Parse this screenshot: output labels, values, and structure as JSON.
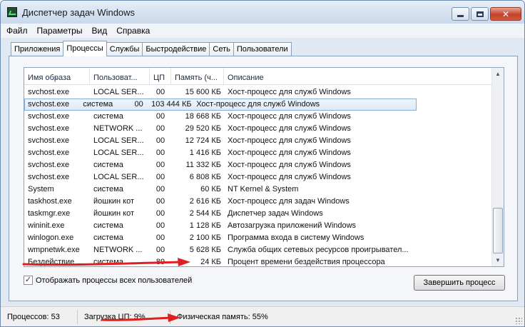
{
  "window": {
    "title": "Диспетчер задач Windows",
    "minimize_icon": "minimize-icon",
    "maximize_icon": "maximize-icon",
    "close_icon": "close-icon",
    "close_glyph": "✕"
  },
  "menu": [
    "Файл",
    "Параметры",
    "Вид",
    "Справка"
  ],
  "tabs": [
    "Приложения",
    "Процессы",
    "Службы",
    "Быстродействие",
    "Сеть",
    "Пользователи"
  ],
  "active_tab": "Процессы",
  "table": {
    "columns": [
      "Имя образа",
      "Пользоват...",
      "ЦП",
      "Память (ч...",
      "Описание"
    ],
    "sort_indicator": "▲",
    "rows": [
      [
        "svchost.exe",
        "LOCAL SER...",
        "00",
        "15 600 КБ",
        "Хост-процесс для служб Windows"
      ],
      [
        "svchost.exe",
        "система",
        "00",
        "103 444 КБ",
        "Хост-процесс для служб Windows"
      ],
      [
        "svchost.exe",
        "система",
        "00",
        "18 668 КБ",
        "Хост-процесс для служб Windows"
      ],
      [
        "svchost.exe",
        "NETWORK ...",
        "00",
        "29 520 КБ",
        "Хост-процесс для служб Windows"
      ],
      [
        "svchost.exe",
        "LOCAL SER...",
        "00",
        "12 724 КБ",
        "Хост-процесс для служб Windows"
      ],
      [
        "svchost.exe",
        "LOCAL SER...",
        "00",
        "1 416 КБ",
        "Хост-процесс для служб Windows"
      ],
      [
        "svchost.exe",
        "система",
        "00",
        "11 332 КБ",
        "Хост-процесс для служб Windows"
      ],
      [
        "svchost.exe",
        "LOCAL SER...",
        "00",
        "6 808 КБ",
        "Хост-процесс для служб Windows"
      ],
      [
        "System",
        "система",
        "00",
        "60 КБ",
        "NT Kernel & System"
      ],
      [
        "taskhost.exe",
        "йошкин кот",
        "00",
        "2 616 КБ",
        "Хост-процесс для задач Windows"
      ],
      [
        "taskmgr.exe",
        "йошкин кот",
        "00",
        "2 544 КБ",
        "Диспетчер задач Windows"
      ],
      [
        "wininit.exe",
        "система",
        "00",
        "1 128 КБ",
        "Автозагрузка приложений Windows"
      ],
      [
        "winlogon.exe",
        "система",
        "00",
        "2 100 КБ",
        "Программа входа в систему Windows"
      ],
      [
        "wmpnetwk.exe",
        "NETWORK ...",
        "00",
        "5 628 КБ",
        "Служба общих сетевых ресурсов проигрывател..."
      ],
      [
        "Бездействие ...",
        "система",
        "89",
        "24 КБ",
        "Процент времени бездействия процессора"
      ]
    ],
    "selected_row": 1
  },
  "show_all_users": {
    "label": "Отображать процессы всех пользователей",
    "checked": true,
    "check_glyph": "✓"
  },
  "end_process_button": "Завершить процесс",
  "scrollbar": {
    "up_glyph": "▲",
    "down_glyph": "▼"
  },
  "status": {
    "processes": "Процессов: 53",
    "cpu": "Загрузка ЦП: 9%",
    "memory": "Физическая память: 55%"
  },
  "colors": {
    "annotation_arrow": "#e02020",
    "selection_border": "#84acdd",
    "window_frame": "#dfe8f3"
  }
}
